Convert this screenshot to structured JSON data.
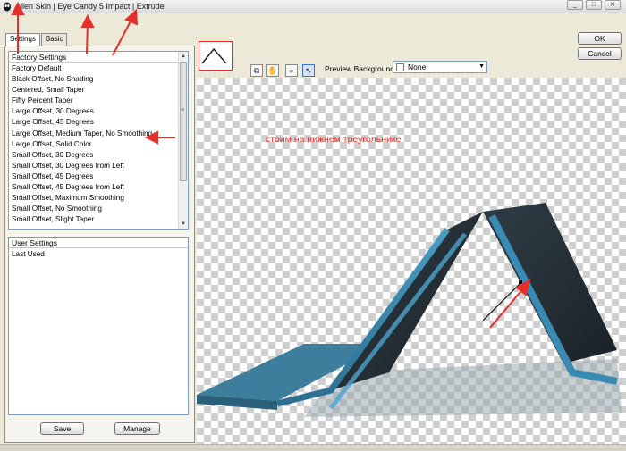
{
  "window": {
    "title": "Alien Skin | Eye Candy 5 Impact | Extrude",
    "controls": [
      "_",
      "□",
      "✕"
    ]
  },
  "tabs": [
    {
      "label": "Settings",
      "active": true
    },
    {
      "label": "Basic",
      "active": false
    }
  ],
  "factory_settings": {
    "header": "Factory Settings",
    "items": [
      "Factory Default",
      "Black Offset, No Shading",
      "Centered, Small Taper",
      "Fifty Percent Taper",
      "Large Offset, 30 Degrees",
      "Large Offset, 45 Degrees",
      "Large Offset, Medium Taper, No Smoothing",
      "Large Offset, Solid Color",
      "Small Offset, 30 Degrees",
      "Small Offset, 30 Degrees from Left",
      "Small Offset, 45 Degrees",
      "Small Offset, 45 Degrees from Left",
      "Small Offset, Maximum Smoothing",
      "Small Offset, No Smoothing",
      "Small Offset, Slight Taper"
    ],
    "selected": "Large Offset, Medium Taper, No Smoothing"
  },
  "user_settings": {
    "header": "User Settings",
    "items": [
      "Last Used"
    ]
  },
  "buttons": {
    "save": "Save",
    "manage": "Manage",
    "ok": "OK",
    "cancel": "Cancel"
  },
  "preview": {
    "background_label": "Preview Background:",
    "background_value": "None",
    "tools": [
      "navigator-icon",
      "hand-icon",
      "zoom-icon",
      "pointer-icon"
    ]
  },
  "annotation": {
    "text": "стоим на нижнем треугольнике",
    "color": "#e5302a"
  },
  "colors": {
    "extrude_face": "#3d7e9c",
    "extrude_edge": "#2a5f79",
    "shadow": "#9aa7ad"
  }
}
